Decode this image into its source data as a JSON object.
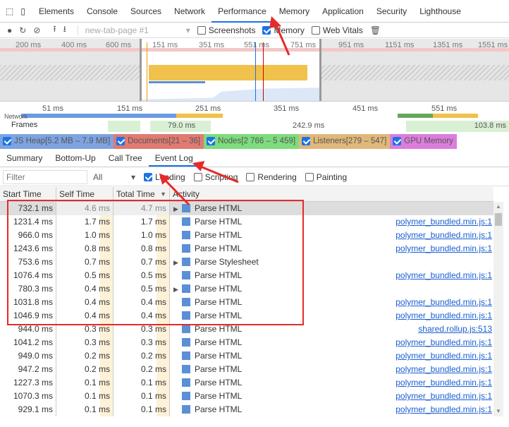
{
  "tabs": [
    "Elements",
    "Console",
    "Sources",
    "Network",
    "Performance",
    "Memory",
    "Application",
    "Security",
    "Lighthouse"
  ],
  "active_tab": "Performance",
  "toolbar": {
    "profile_select": "new-tab-page #1",
    "screenshots": {
      "label": "Screenshots",
      "checked": false
    },
    "memory": {
      "label": "Memory",
      "checked": true
    },
    "web_vitals": {
      "label": "Web Vitals",
      "checked": false
    }
  },
  "overview_ticks": [
    "200 ms",
    "400 ms",
    "600 ms",
    "151 ms",
    "351 ms",
    "551 ms",
    "751 ms",
    "951 ms",
    "1151 ms",
    "1351 ms",
    "1551 ms"
  ],
  "timeline_ticks": [
    "51 ms",
    "151 ms",
    "251 ms",
    "351 ms",
    "451 ms",
    "551 ms"
  ],
  "tracks": {
    "network": "Network",
    "frames": "Frames",
    "frame_times": [
      "79.0 ms",
      "242.9 ms",
      "103.8 ms"
    ]
  },
  "counters": [
    {
      "label": "JS Heap[5.2 MB – 7.9 MB]",
      "color": "#7ea3e0"
    },
    {
      "label": "Documents[21 – 36]",
      "color": "#e07a73"
    },
    {
      "label": "Nodes[2 766 – 5 459]",
      "color": "#7ddc7d"
    },
    {
      "label": "Listeners[279 – 547]",
      "color": "#e0b87a"
    },
    {
      "label": "GPU Memory",
      "color": "#dc7ddc"
    }
  ],
  "subtabs": [
    "Summary",
    "Bottom-Up",
    "Call Tree",
    "Event Log"
  ],
  "active_subtab": "Event Log",
  "filter": {
    "placeholder": "Filter",
    "duration": "All",
    "loading": {
      "label": "Loading",
      "checked": true
    },
    "scripting": {
      "label": "Scripting",
      "checked": false
    },
    "rendering": {
      "label": "Rendering",
      "checked": false
    },
    "painting": {
      "label": "Painting",
      "checked": false
    }
  },
  "columns": [
    "Start Time",
    "Self Time",
    "Total Time",
    "Activity"
  ],
  "rows": [
    {
      "start": "732.1 ms",
      "self": "4.6 ms",
      "total": "4.7 ms",
      "activity": "Parse HTML",
      "expand": true,
      "link": "",
      "selected": true
    },
    {
      "start": "1231.4 ms",
      "self": "1.7 ms",
      "total": "1.7 ms",
      "activity": "Parse HTML",
      "expand": false,
      "link": "polymer_bundled.min.js:1"
    },
    {
      "start": "966.0 ms",
      "self": "1.0 ms",
      "total": "1.0 ms",
      "activity": "Parse HTML",
      "expand": false,
      "link": "polymer_bundled.min.js:1"
    },
    {
      "start": "1243.6 ms",
      "self": "0.8 ms",
      "total": "0.8 ms",
      "activity": "Parse HTML",
      "expand": false,
      "link": "polymer_bundled.min.js:1"
    },
    {
      "start": "753.6 ms",
      "self": "0.7 ms",
      "total": "0.7 ms",
      "activity": "Parse Stylesheet",
      "expand": true,
      "link": ""
    },
    {
      "start": "1076.4 ms",
      "self": "0.5 ms",
      "total": "0.5 ms",
      "activity": "Parse HTML",
      "expand": false,
      "link": "polymer_bundled.min.js:1"
    },
    {
      "start": "780.3 ms",
      "self": "0.4 ms",
      "total": "0.5 ms",
      "activity": "Parse HTML",
      "expand": true,
      "link": ""
    },
    {
      "start": "1031.8 ms",
      "self": "0.4 ms",
      "total": "0.4 ms",
      "activity": "Parse HTML",
      "expand": false,
      "link": "polymer_bundled.min.js:1"
    },
    {
      "start": "1046.9 ms",
      "self": "0.4 ms",
      "total": "0.4 ms",
      "activity": "Parse HTML",
      "expand": false,
      "link": "polymer_bundled.min.js:1"
    },
    {
      "start": "944.0 ms",
      "self": "0.3 ms",
      "total": "0.3 ms",
      "activity": "Parse HTML",
      "expand": false,
      "link": "shared.rollup.js:513"
    },
    {
      "start": "1041.2 ms",
      "self": "0.3 ms",
      "total": "0.3 ms",
      "activity": "Parse HTML",
      "expand": false,
      "link": "polymer_bundled.min.js:1"
    },
    {
      "start": "949.0 ms",
      "self": "0.2 ms",
      "total": "0.2 ms",
      "activity": "Parse HTML",
      "expand": false,
      "link": "polymer_bundled.min.js:1"
    },
    {
      "start": "947.2 ms",
      "self": "0.2 ms",
      "total": "0.2 ms",
      "activity": "Parse HTML",
      "expand": false,
      "link": "polymer_bundled.min.js:1"
    },
    {
      "start": "1227.3 ms",
      "self": "0.1 ms",
      "total": "0.1 ms",
      "activity": "Parse HTML",
      "expand": false,
      "link": "polymer_bundled.min.js:1"
    },
    {
      "start": "1070.3 ms",
      "self": "0.1 ms",
      "total": "0.1 ms",
      "activity": "Parse HTML",
      "expand": false,
      "link": "polymer_bundled.min.js:1"
    },
    {
      "start": "929.1 ms",
      "self": "0.1 ms",
      "total": "0.1 ms",
      "activity": "Parse HTML",
      "expand": false,
      "link": "polymer_bundled.min.js:1"
    }
  ]
}
